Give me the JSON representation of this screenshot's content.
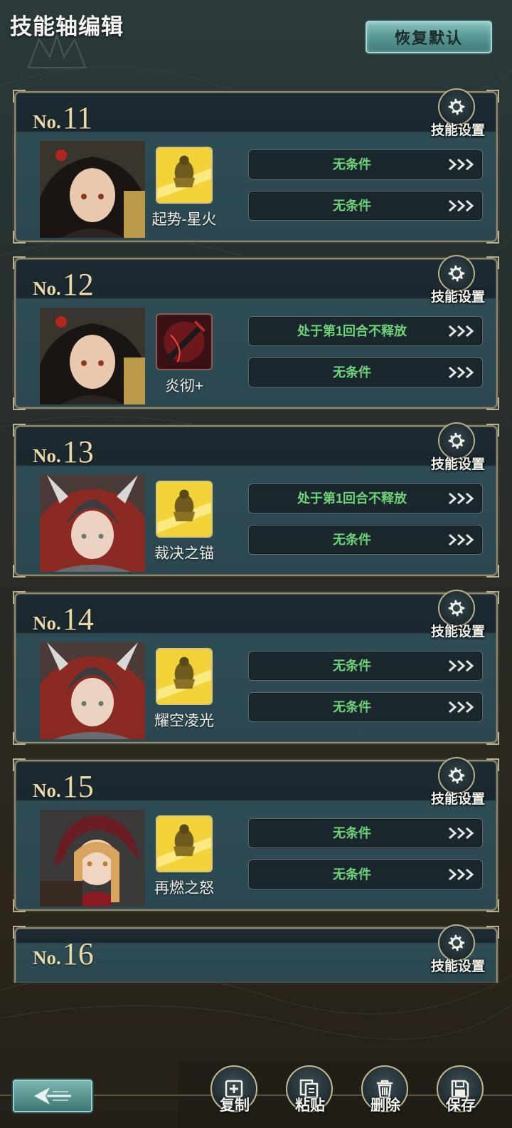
{
  "header": {
    "title": "技能轴编辑",
    "reset_label": "恢复默认"
  },
  "gear_label": "技能设置",
  "cards": [
    {
      "prefix": "No.",
      "number": "11",
      "skill": "起势-星火",
      "skill_icon": "golden-warrior-skill-icon",
      "portrait": "black-haired-woman-portrait",
      "conditions": [
        "无条件",
        "无条件"
      ]
    },
    {
      "prefix": "No.",
      "number": "12",
      "skill": "炎彻+",
      "skill_icon": "red-sword-skill-icon",
      "portrait": "black-haired-woman-portrait",
      "conditions": [
        "处于第1回合不释放",
        "无条件"
      ]
    },
    {
      "prefix": "No.",
      "number": "13",
      "skill": "裁决之锚",
      "skill_icon": "golden-warrior-skill-icon",
      "portrait": "red-haired-helmet-knight-portrait",
      "conditions": [
        "处于第1回合不释放",
        "无条件"
      ]
    },
    {
      "prefix": "No.",
      "number": "14",
      "skill": "耀空凌光",
      "skill_icon": "golden-warrior-skill-icon",
      "portrait": "red-haired-helmet-knight-portrait",
      "conditions": [
        "无条件",
        "无条件"
      ]
    },
    {
      "prefix": "No.",
      "number": "15",
      "skill": "再燃之怒",
      "skill_icon": "golden-warrior-skill-icon",
      "portrait": "blonde-red-hood-girl-portrait",
      "conditions": [
        "无条件",
        "无条件"
      ]
    },
    {
      "prefix": "No.",
      "number": "16",
      "skill": "",
      "skill_icon": "",
      "portrait": "",
      "conditions": []
    }
  ],
  "actions": {
    "copy": "复制",
    "paste": "粘贴",
    "delete": "删除",
    "save": "保存"
  },
  "colors": {
    "condition_text": "#6fd27a",
    "number_gold": "#e8d9a6",
    "frame": "#8e8a72",
    "accent_teal": "#5a9a97"
  }
}
